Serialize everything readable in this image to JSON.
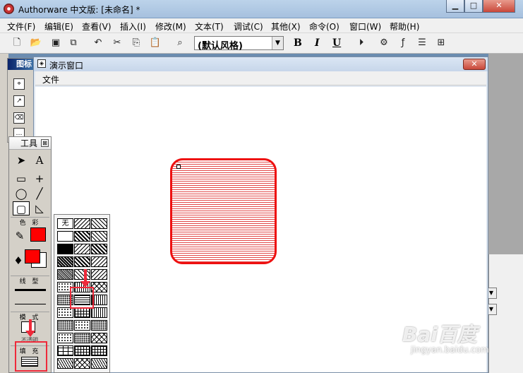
{
  "app": {
    "title": "Authorware 中文版: [未命名] *"
  },
  "window_controls": {
    "minimize": "▁",
    "maximize": "□",
    "close": "✕"
  },
  "menubar": [
    "文件(F)",
    "编辑(E)",
    "查看(V)",
    "插入(I)",
    "修改(M)",
    "文本(T)",
    "调试(C)",
    "其他(X)",
    "命令(O)",
    "窗口(W)",
    "帮助(H)"
  ],
  "toolbar": {
    "style_select": "(默认风格)",
    "bold": "B",
    "italic": "I",
    "underline": "U"
  },
  "icon_palette": {
    "title": "图标"
  },
  "presentation_window": {
    "title": "演示窗口",
    "close": "✕",
    "menu": [
      "文件"
    ]
  },
  "tools_palette": {
    "title": "工具",
    "close": "⊠",
    "section_color": "色 彩",
    "section_line": "线 型",
    "section_mode": "模 式",
    "mode_value": "不透明",
    "section_fill": "填 充"
  },
  "fill_popup": {
    "none_label": "无",
    "selected_pattern": "horizontal-lines"
  },
  "shape": {
    "fill_color": "#e24848",
    "border_color": "#ee1111"
  },
  "colors": {
    "accent_red": "#ee2a3a",
    "foreground_color": "#ff0000"
  },
  "watermark": {
    "brand": "Bai百度",
    "sub": "jingyan.baidu.com"
  }
}
